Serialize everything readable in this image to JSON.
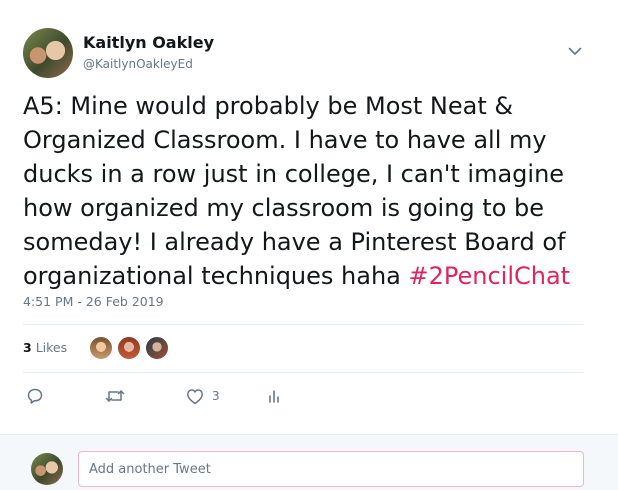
{
  "author": {
    "name": "Kaitlyn Oakley",
    "handle": "@KaitlynOakleyEd"
  },
  "tweet": {
    "lines": [
      "A5: Mine would probably be Most Neat &",
      "Organized Classroom. I have to have all my",
      "ducks in a row just in college, I can't imagine",
      "how organized my classroom is going to be",
      "someday! I already have a Pinterest Board of"
    ],
    "last_line_text": "organizational techniques haha ",
    "hashtag": "#2PencilChat",
    "timestamp": "4:51 PM - 26 Feb 2019"
  },
  "stats": {
    "likes_count": "3",
    "likes_label": "Likes"
  },
  "actions": {
    "reply_icon": "reply-icon",
    "retweet_icon": "retweet-icon",
    "like_icon": "heart-icon",
    "like_count": "3",
    "analytics_icon": "analytics-icon"
  },
  "reply": {
    "placeholder": "Add another Tweet"
  },
  "colors": {
    "hashtag": "#e0245e",
    "secondary_text": "#657786",
    "divider": "#e6ecf0",
    "footer_bg": "#f5f8fa",
    "input_border": "#f0b7c8"
  }
}
